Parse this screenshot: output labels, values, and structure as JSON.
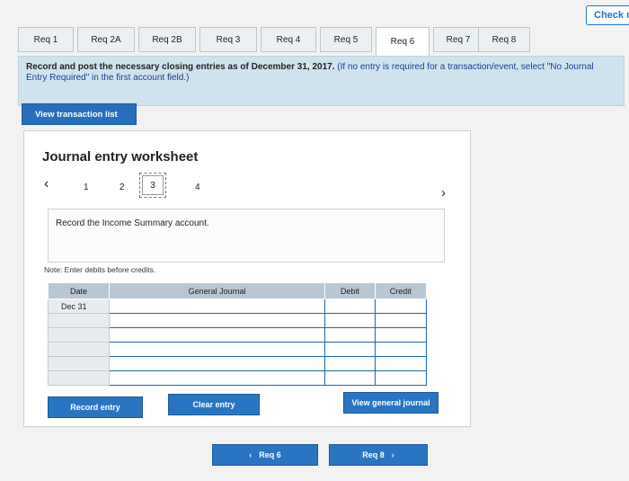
{
  "header": {
    "check_label": "Check m"
  },
  "tabs": [
    "Req 1",
    "Req 2A",
    "Req 2B",
    "Req 3",
    "Req 4",
    "Req 5",
    "Req 6",
    "Req 7",
    "Req 8"
  ],
  "instructions": {
    "main": "Record and post the necessary closing entries as of December 31, 2017.",
    "hint": "(If no entry is required for a transaction/event, select \"No Journal Entry Required\" in the first account field.)"
  },
  "view_transaction_label": "View transaction list",
  "worksheet": {
    "title": "Journal entry worksheet",
    "prev_icon": "‹",
    "next_icon": "›",
    "pages": [
      "1",
      "2",
      "3",
      "4"
    ],
    "current_page": "3",
    "description": "Record the Income Summary account.",
    "note": "Note: Enter debits before credits.",
    "columns": {
      "date": "Date",
      "account": "General Journal",
      "debit": "Debit",
      "credit": "Credit"
    },
    "first_date": "Dec 31"
  },
  "buttons": {
    "record": "Record entry",
    "clear": "Clear entry",
    "view_journal": "View general journal"
  },
  "footer": {
    "prev": "Req 6",
    "next": "Req 8"
  }
}
